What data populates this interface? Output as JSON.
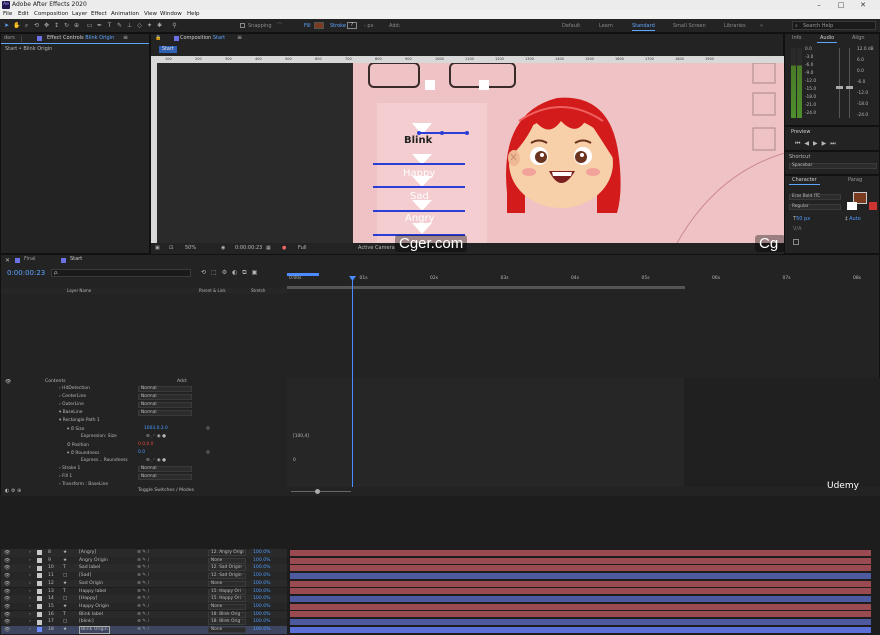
{
  "window": {
    "title": "Adobe After Effects 2020",
    "logo": "Ae"
  },
  "menu": [
    "File",
    "Edit",
    "Composition",
    "Layer",
    "Effect",
    "Animation",
    "View",
    "Window",
    "Help"
  ],
  "toolbar": {
    "snapping": "Snapping",
    "fill": "Fill",
    "stroke": "Stroke",
    "stroke_px": "- px",
    "add": "Add:",
    "workspaces": [
      "Default",
      "Learn",
      "Standard",
      "Small Screen",
      "Libraries"
    ],
    "active_workspace": "Standard",
    "search": "Search Help"
  },
  "left_panels": {
    "project_tab": "ders",
    "effect_controls_tab": "Effect Controls",
    "effect_controls_layer": "Blink Origin",
    "breadcrumb": "Start • Blink Origin"
  },
  "comp": {
    "tab": "Composition",
    "comp_name": "Start",
    "subtab": "Start",
    "ruler": [
      "100",
      "200",
      "300",
      "400",
      "500",
      "600",
      "700",
      "800",
      "900",
      "1000",
      "1100",
      "1200",
      "1300",
      "1400",
      "1500",
      "1600",
      "1700",
      "1800",
      "1900"
    ],
    "zoom": "50%",
    "timecode": "0:00:00:23",
    "resolution": "Full",
    "camera": "Active Camera",
    "labels": {
      "blink": "Blink",
      "happy": "Happy",
      "sad": "Sad",
      "angry": "Angry"
    }
  },
  "watermark": "Cger.com",
  "right": {
    "tabs": [
      "Info",
      "Audio",
      "Align"
    ],
    "db_right": [
      "12.0 dB",
      "6.0",
      "0.0",
      "-6.0",
      "-12.0",
      "-18.0",
      "-24.0"
    ],
    "db_left": [
      "0.0",
      "-3.0",
      "-6.0",
      "-9.0",
      "-12.0",
      "-15.0",
      "-18.0",
      "-21.0",
      "-24.0"
    ],
    "preview": "Preview",
    "shortcut_label": "Shortcut",
    "shortcut": "Spacebar",
    "char_tabs": [
      "Character",
      "Parag"
    ],
    "font": "Eras Bold ITC",
    "style": "Regular",
    "size": "50 px",
    "leading": "Auto"
  },
  "timeline": {
    "tabs": [
      "Final",
      "Start"
    ],
    "timecode": "0:00:00:23",
    "search": "ρ.",
    "headers": {
      "layer_name": "Layer Name",
      "parent": "Parent & Link",
      "stretch": "Stretch"
    },
    "ticks": [
      "0:00s",
      "01s",
      "02s",
      "03s",
      "04s",
      "05s",
      "06s",
      "07s",
      "08s"
    ],
    "layers": [
      {
        "num": "8",
        "type": "★",
        "name": "[Angry]",
        "parent": "12. Angry Origi",
        "stretch": "100.0%",
        "color": "#c8c8c8"
      },
      {
        "num": "9",
        "type": "★",
        "name": "Angry Origin",
        "parent": "None",
        "stretch": "100.0%",
        "color": "#c8c8c8"
      },
      {
        "num": "10",
        "type": "T",
        "name": "Sad label",
        "parent": "12. Sad Origin",
        "stretch": "100.0%",
        "color": "#c8c8c8"
      },
      {
        "num": "11",
        "type": "□",
        "name": "[Sad]",
        "parent": "12. Sad Origin",
        "stretch": "100.0%",
        "color": "#c8c8c8"
      },
      {
        "num": "12",
        "type": "★",
        "name": "Sad Origin",
        "parent": "None",
        "stretch": "100.0%",
        "color": "#c8c8c8"
      },
      {
        "num": "13",
        "type": "T",
        "name": "Happy label",
        "parent": "15. Happy Ori",
        "stretch": "100.0%",
        "color": "#c8c8c8"
      },
      {
        "num": "14",
        "type": "□",
        "name": "[Happy]",
        "parent": "15. Happy Ori",
        "stretch": "100.0%",
        "color": "#c8c8c8"
      },
      {
        "num": "15",
        "type": "★",
        "name": "Happy Origin",
        "parent": "None",
        "stretch": "100.0%",
        "color": "#c8c8c8"
      },
      {
        "num": "16",
        "type": "T",
        "name": "Blink label",
        "parent": "18. Blink Orig",
        "stretch": "100.0%",
        "color": "#c8c8c8"
      },
      {
        "num": "17",
        "type": "□",
        "name": "[blink]",
        "parent": "18. Blink Orig",
        "stretch": "100.0%",
        "color": "#c8c8c8"
      },
      {
        "num": "18",
        "type": "★",
        "name": "Blink Origin",
        "parent": "None",
        "stretch": "100.0%",
        "color": "#6d8cff"
      }
    ],
    "contents": {
      "label": "Contents",
      "add": "Add:",
      "groups": [
        {
          "name": "HitDetection",
          "mode": "Normal"
        },
        {
          "name": "CenterLine",
          "mode": "Normal"
        },
        {
          "name": "OuterLine",
          "mode": "Normal"
        },
        {
          "name": "BaseLine",
          "mode": "Normal"
        }
      ],
      "rect_path": "Rectangle Path 1",
      "size": "Size",
      "size_val": "1003.0,3.0",
      "expr_size": "Expression: Size",
      "position": "Position",
      "position_val": "0.0,0.0",
      "roundness": "Roundness",
      "roundness_val": "0.0",
      "expr_round": "Express... Roundness",
      "stroke": "Stroke 1",
      "stroke_mode": "Normal",
      "fill": "Fill 1",
      "fill_mode": "Normal",
      "transform": "Transform : BaseLine",
      "graph_vals": [
        "[100,4]",
        "0"
      ]
    },
    "footer": "Toggle Switches / Modes"
  },
  "udemy": "Udemy"
}
